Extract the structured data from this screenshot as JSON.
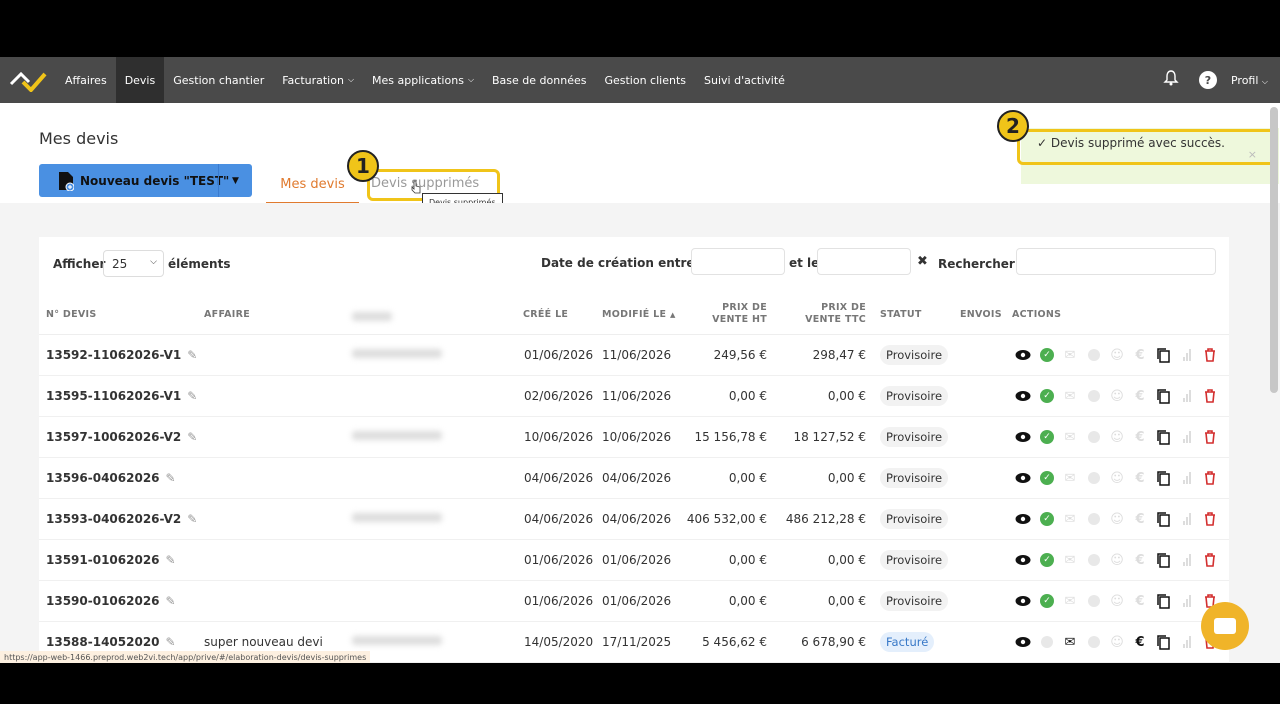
{
  "nav": {
    "items": [
      {
        "label": "Affaires",
        "caret": false,
        "active": false
      },
      {
        "label": "Devis",
        "caret": false,
        "active": true
      },
      {
        "label": "Gestion chantier",
        "caret": false,
        "active": false
      },
      {
        "label": "Facturation",
        "caret": true,
        "active": false
      },
      {
        "label": "Mes applications",
        "caret": true,
        "active": false
      },
      {
        "label": "Base de données",
        "caret": false,
        "active": false
      },
      {
        "label": "Gestion clients",
        "caret": false,
        "active": false
      },
      {
        "label": "Suivi d'activité",
        "caret": false,
        "active": false
      }
    ],
    "help": "?",
    "profile": "Profil"
  },
  "page": {
    "title": "Mes devis",
    "new_button": "Nouveau devis \"TEST\"",
    "tabs": {
      "mine": "Mes devis",
      "deleted": "Devis supprimés"
    },
    "tooltip": "Devis supprimés"
  },
  "annotations": {
    "step1": "1",
    "step2": "2"
  },
  "toast": {
    "message": "✓ Devis supprimé avec succès.",
    "close": "×"
  },
  "controls": {
    "show_label": "Afficher",
    "page_size": "25",
    "elements_label": "éléments",
    "date_label": "Date de création entre le",
    "and_label": "et le",
    "clear": "✖",
    "search_label": "Rechercher :"
  },
  "table": {
    "headers": {
      "num": "N° DEVIS",
      "affaire": "AFFAIRE",
      "created": "CRÉÉ LE",
      "modified": "MODIFIÉ LE",
      "ht1": "PRIX DE",
      "ht2": "VENTE HT",
      "ttc1": "PRIX DE",
      "ttc2": "VENTE TTC",
      "status": "STATUT",
      "sends": "ENVOIS",
      "actions": "ACTIONS"
    },
    "rows": [
      {
        "num": "13592-11062026-V1",
        "affaire": "",
        "created": "01/06/2026",
        "modified": "11/06/2026",
        "ht": "249,56 €",
        "ttc": "298,47 €",
        "status": "Provisoire"
      },
      {
        "num": "13595-11062026-V1",
        "affaire": "",
        "created": "02/06/2026",
        "modified": "11/06/2026",
        "ht": "0,00 €",
        "ttc": "0,00 €",
        "status": "Provisoire"
      },
      {
        "num": "13597-10062026-V2",
        "affaire": "",
        "created": "10/06/2026",
        "modified": "10/06/2026",
        "ht": "15 156,78 €",
        "ttc": "18 127,52 €",
        "status": "Provisoire"
      },
      {
        "num": "13596-04062026",
        "affaire": "",
        "created": "04/06/2026",
        "modified": "04/06/2026",
        "ht": "0,00 €",
        "ttc": "0,00 €",
        "status": "Provisoire"
      },
      {
        "num": "13593-04062026-V2",
        "affaire": "",
        "created": "04/06/2026",
        "modified": "04/06/2026",
        "ht": "406 532,00 €",
        "ttc": "486 212,28 €",
        "status": "Provisoire"
      },
      {
        "num": "13591-01062026",
        "affaire": "",
        "created": "01/06/2026",
        "modified": "01/06/2026",
        "ht": "0,00 €",
        "ttc": "0,00 €",
        "status": "Provisoire"
      },
      {
        "num": "13590-01062026",
        "affaire": "",
        "created": "01/06/2026",
        "modified": "01/06/2026",
        "ht": "0,00 €",
        "ttc": "0,00 €",
        "status": "Provisoire"
      },
      {
        "num": "13588-14052020",
        "affaire": "super nouveau devi",
        "created": "14/05/2020",
        "modified": "17/11/2025",
        "ht": "5 456,62 €",
        "ttc": "6 678,90 €",
        "status": "Facturé"
      }
    ]
  },
  "statusbar_url": "https://app-web-1466.preprod.web2vi.tech/app/prive/#/elaboration-devis/devis-supprimes",
  "colors": {
    "accent": "#e07a2e",
    "primary_button": "#4a90e2",
    "highlight": "#f0c419",
    "navbar": "#4a4a4a"
  }
}
